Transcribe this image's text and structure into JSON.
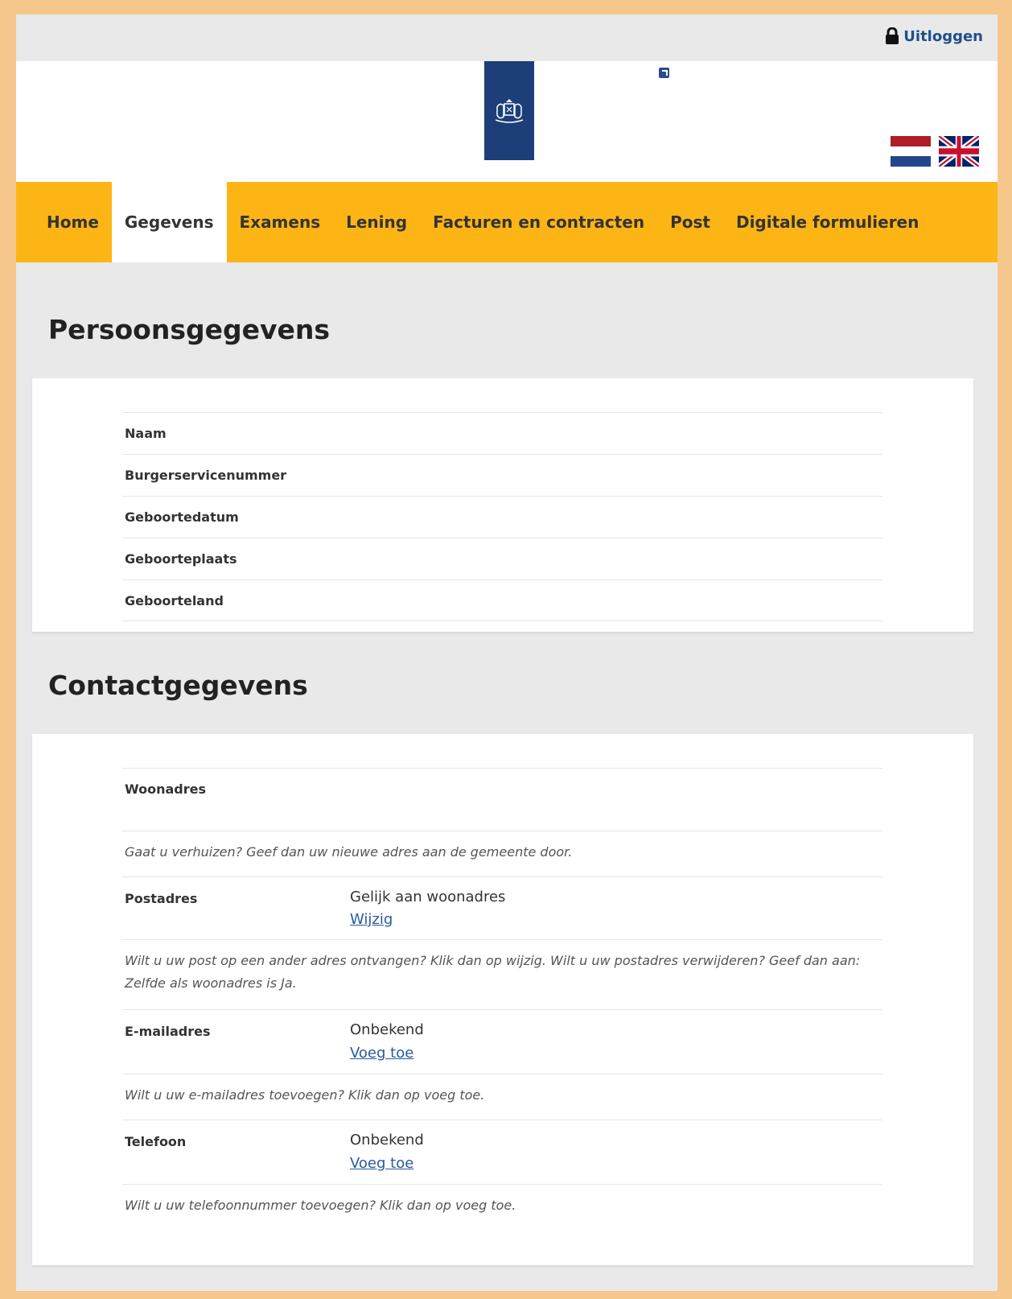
{
  "topbar": {
    "logout_label": "Uitloggen"
  },
  "header": {
    "logo": "rijksoverheid-coat-of-arms",
    "lang_flags": [
      "Nederlands",
      "English"
    ]
  },
  "nav": {
    "items": [
      {
        "label": "Home",
        "active": false
      },
      {
        "label": "Gegevens",
        "active": true
      },
      {
        "label": "Examens",
        "active": false
      },
      {
        "label": "Lening",
        "active": false
      },
      {
        "label": "Facturen en contracten",
        "active": false
      },
      {
        "label": "Post",
        "active": false
      },
      {
        "label": "Digitale formulieren",
        "active": false
      }
    ]
  },
  "personal": {
    "title": "Persoonsgegevens",
    "rows": [
      "Naam",
      "Burgerservicenummer",
      "Geboortedatum",
      "Geboorteplaats",
      "Geboorteland"
    ]
  },
  "contact": {
    "title": "Contactgegevens",
    "woonadres_label": "Woonadres",
    "woonadres_hint": "Gaat u verhuizen? Geef dan uw nieuwe adres aan de gemeente door.",
    "postadres_label": "Postadres",
    "postadres_value": "Gelijk aan woonadres",
    "postadres_link": "Wijzig",
    "postadres_hint": "Wilt u uw post op een ander adres ontvangen? Klik dan op wijzig. Wilt u uw postadres verwijderen? Geef dan aan: Zelfde als woonadres is Ja.",
    "email_label": "E-mailadres",
    "email_value": "Onbekend",
    "email_link": "Voeg toe",
    "email_hint": "Wilt u uw e-mailadres toevoegen? Klik dan op voeg toe.",
    "phone_label": "Telefoon",
    "phone_value": "Onbekend",
    "phone_link": "Voeg toe",
    "phone_hint": "Wilt u uw telefoonnummer toevoegen? Klik dan op voeg toe."
  },
  "colors": {
    "nav_bg": "#fdb515",
    "brand_blue": "#1c3f7a",
    "link": "#2b5aa0",
    "frame_border": "#f6c78c"
  }
}
